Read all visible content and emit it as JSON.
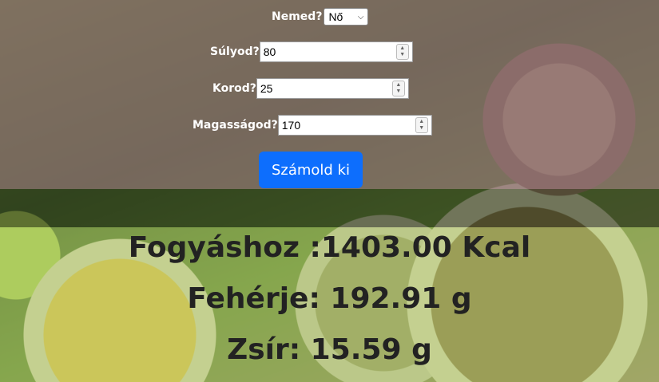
{
  "form": {
    "gender_label": "Nemed?",
    "gender_value": "Nő",
    "weight_label": "Súlyod?",
    "weight_value": "80",
    "age_label": "Korod?",
    "age_value": "25",
    "height_label": "Magasságod?",
    "height_value": "170",
    "submit_label": "Számold ki"
  },
  "results": {
    "calories": "Fogyáshoz :1403.00 Kcal",
    "protein": "Fehérje: 192.91 g",
    "fat": "Zsír: 15.59 g"
  }
}
